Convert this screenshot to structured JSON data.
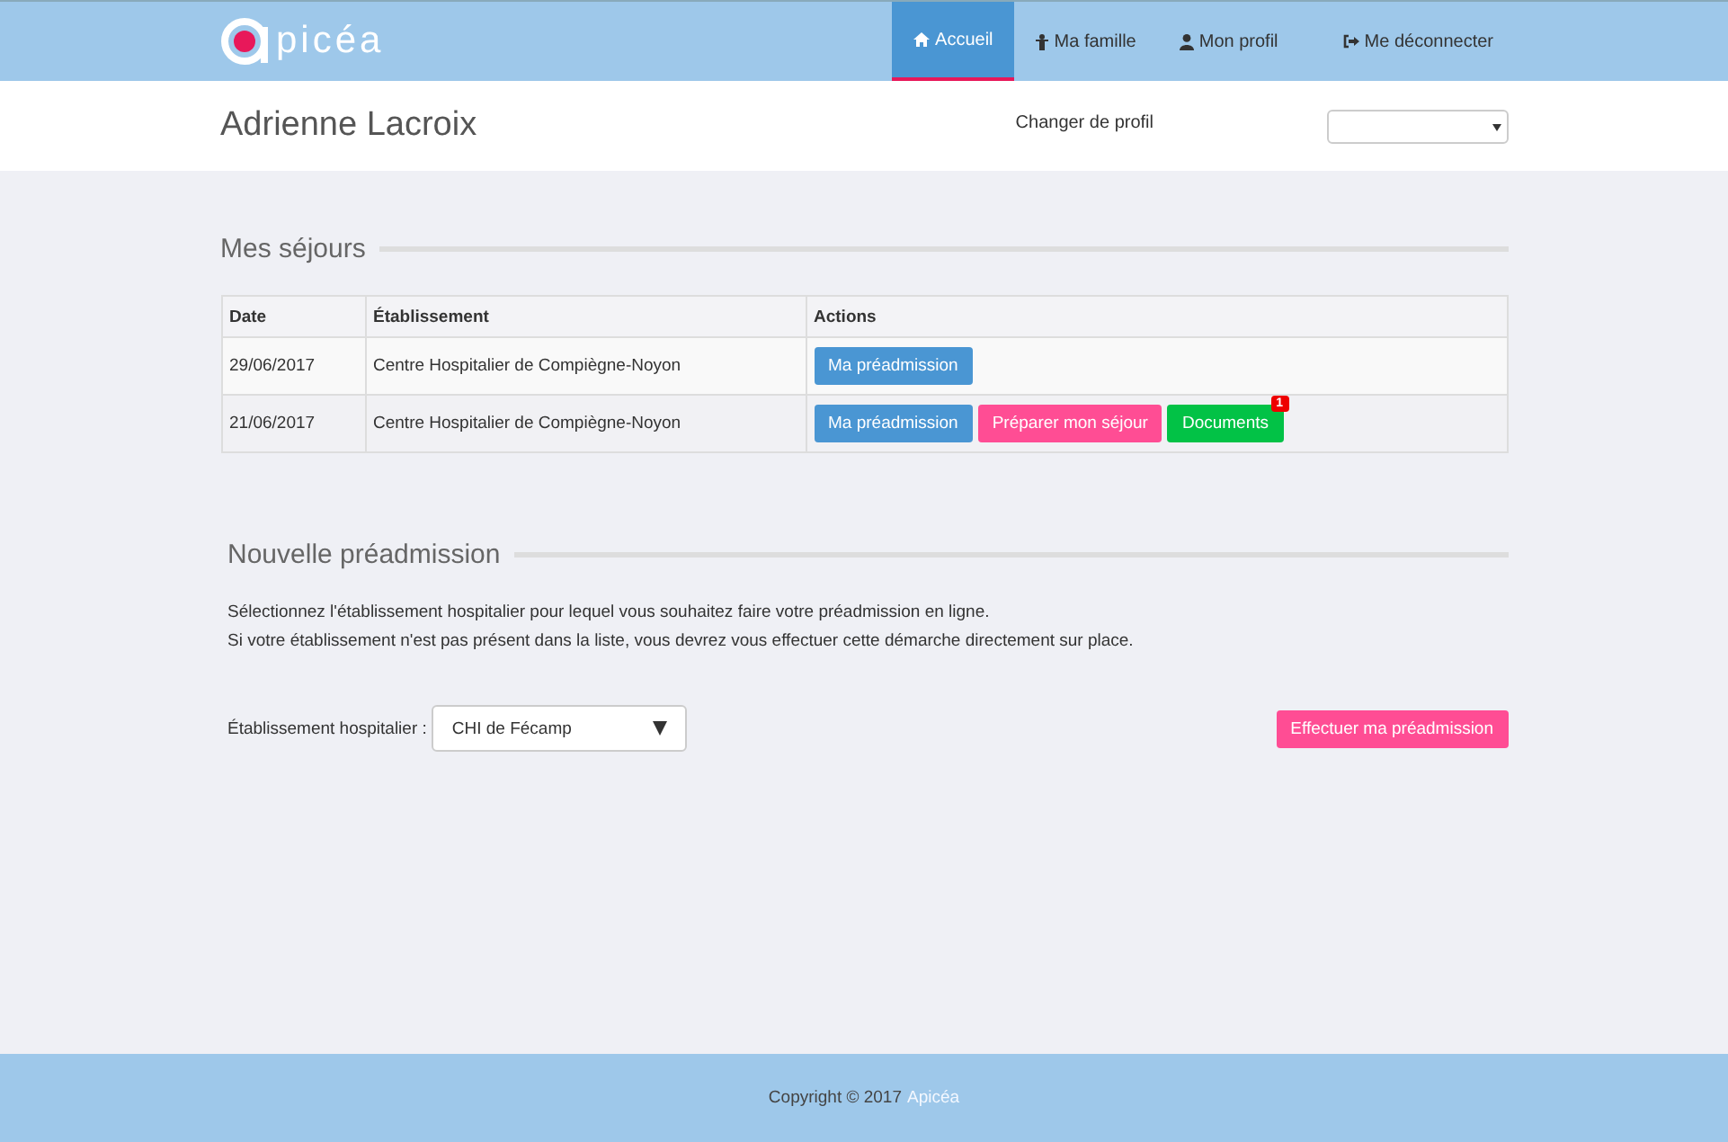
{
  "logo": {
    "text": "picéa"
  },
  "nav": [
    {
      "label": "Accueil",
      "kind": "home",
      "selected": true
    },
    {
      "label": "Ma famille",
      "kind": "family",
      "selected": false
    },
    {
      "label": "Mon profil",
      "kind": "user",
      "selected": false
    },
    {
      "label": "Me déconnecter",
      "kind": "logout",
      "selected": false
    }
  ],
  "profile": {
    "name": "Adrienne Lacroix",
    "switch_label": "Changer de profil"
  },
  "stays": {
    "title": "Mes séjours",
    "columns": [
      "Date",
      "Établissement",
      "Actions"
    ],
    "rows": [
      {
        "date": "29/06/2017",
        "facility": "Centre Hospitalier de Compiègne-Noyon",
        "actions": [
          {
            "label": "Ma préadmission",
            "kind": "primary"
          }
        ]
      },
      {
        "date": "21/06/2017",
        "facility": "Centre Hospitalier de Compiègne-Noyon",
        "actions": [
          {
            "label": "Ma préadmission",
            "kind": "primary"
          },
          {
            "label": "Préparer mon séjour",
            "kind": "pink"
          },
          {
            "label": "Documents",
            "kind": "success",
            "badge": "1"
          }
        ]
      }
    ]
  },
  "new_admission": {
    "title": "Nouvelle préadmission",
    "lines": [
      "Sélectionnez l'établissement hospitalier pour lequel vous souhaitez faire votre préadmission en ligne.",
      "Si votre établissement n'est pas présent dans la liste, vous devrez vous effectuer cette démarche directement sur place."
    ],
    "field_label": "Établissement hospitalier :",
    "field_value": "CHI de Fécamp",
    "button": "Effectuer ma préadmission"
  },
  "footer": {
    "text": "Copyright © 2017",
    "link": "Apicéa"
  }
}
